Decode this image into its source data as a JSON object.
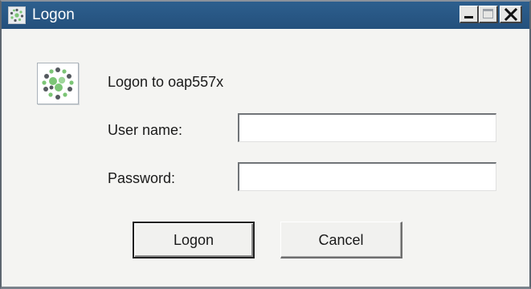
{
  "window": {
    "title": "Logon",
    "title_icon": "app-logo-icon",
    "controls": {
      "minimize": "minimize-icon",
      "maximize": "maximize-icon",
      "close": "close-icon"
    }
  },
  "dialog": {
    "logo_icon": "app-logo-icon",
    "heading": "Logon to oap557x",
    "username": {
      "label": "User name:",
      "value": "",
      "placeholder": ""
    },
    "password": {
      "label": "Password:",
      "value": "",
      "placeholder": ""
    },
    "buttons": {
      "logon": "Logon",
      "cancel": "Cancel"
    }
  },
  "colors": {
    "titlebar": "#2d5f8e",
    "window_bg": "#f4f4f2",
    "logo_green": "#7cc576",
    "logo_dark": "#555a5f"
  }
}
